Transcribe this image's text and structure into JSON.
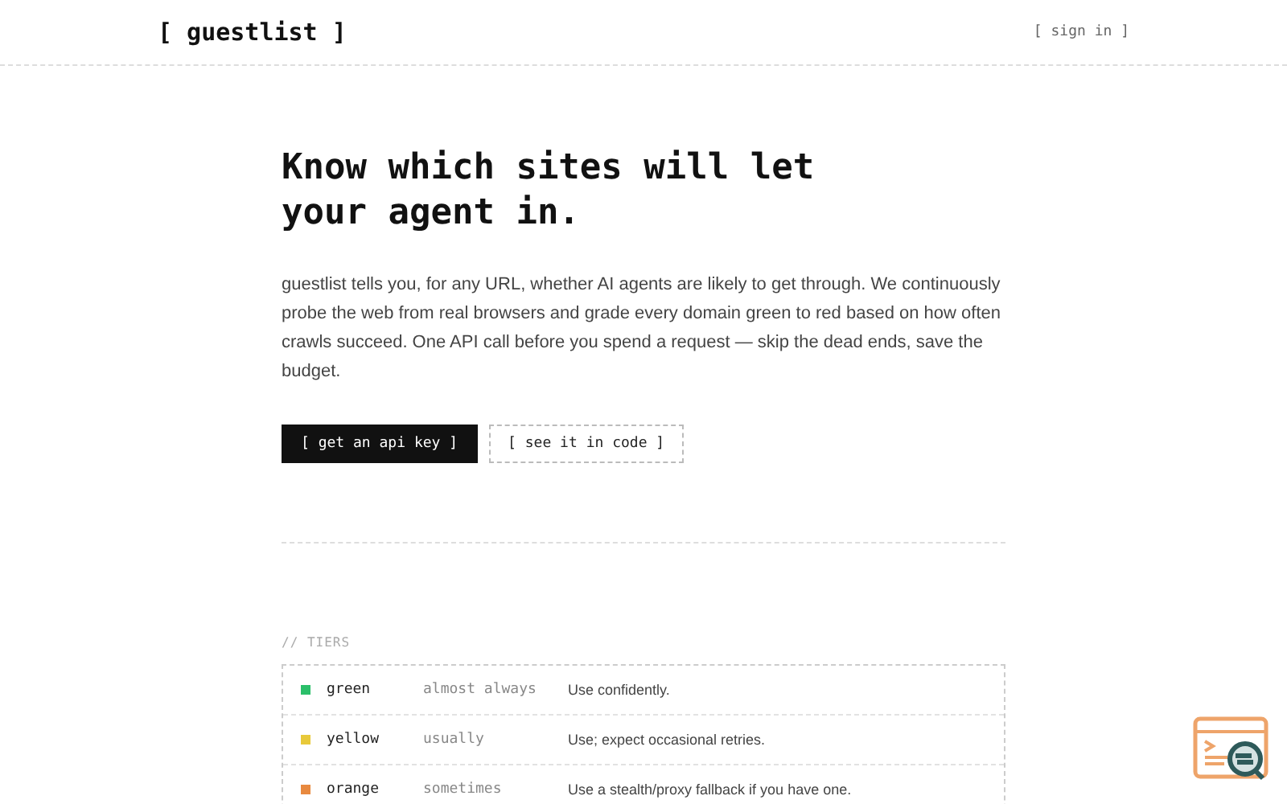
{
  "header": {
    "logo": "[ guestlist ]",
    "sign_in": "[ sign in ]"
  },
  "hero": {
    "title": "Know which sites will let your agent in.",
    "description": "guestlist tells you, for any URL, whether AI agents are likely to get through. We continuously probe the web from real browsers and grade every domain green to red based on how often crawls succeed. One API call before you spend a request — skip the dead ends, save the budget.",
    "buttons": [
      {
        "label": "[ get an api key ]",
        "kind": "primary"
      },
      {
        "label": "[ see it in code ]",
        "kind": "secondary"
      }
    ]
  },
  "tiers": {
    "heading": "// TIERS",
    "rows": [
      {
        "name": "green",
        "color": "#2bbf6a",
        "frequency": "almost always",
        "advice": "Use confidently."
      },
      {
        "name": "yellow",
        "color": "#e8c93a",
        "frequency": "usually",
        "advice": "Use; expect occasional retries."
      },
      {
        "name": "orange",
        "color": "#e8893f",
        "frequency": "sometimes",
        "advice": "Use a stealth/proxy fallback if you have one."
      }
    ]
  }
}
